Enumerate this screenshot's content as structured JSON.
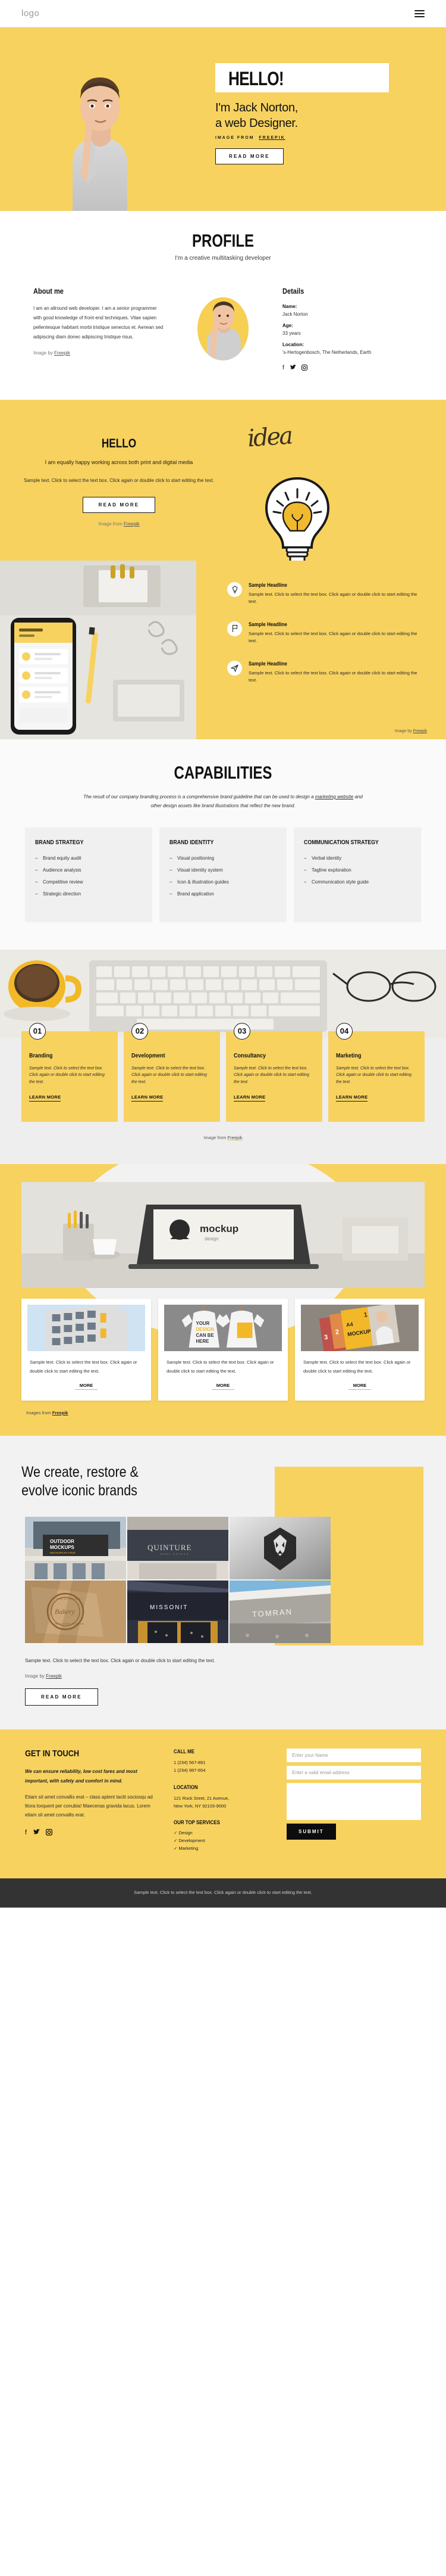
{
  "header": {
    "logo": "logo",
    "menu_icon": "hamburger-menu"
  },
  "hero": {
    "hello": "HELLO!",
    "headline_line1": "I'm Jack Norton,",
    "headline_line2": "a web Designer.",
    "credit_prefix": "IMAGE FROM",
    "credit_link": "FREEPIK",
    "cta": "READ MORE"
  },
  "profile": {
    "title": "PROFILE",
    "subtitle": "I'm a creative multitasking developer",
    "about_title": "About me",
    "about_text": "I am an allround web developer. I am a senior programmer with good knowledge of front-end techniques. Vitae sapien pellentesque habitant morbi tristique senectus et. Aenean sed adipiscing diam donec adipiscing tristique risus.",
    "about_credit_prefix": "Image by",
    "about_credit_link": "Freepik",
    "details_title": "Details",
    "details": [
      {
        "key": "Name:",
        "value": "Jack Norton"
      },
      {
        "key": "Age:",
        "value": "33 years"
      },
      {
        "key": "Location:",
        "value": "'s-Hertogenbosch, The Netherlands, Earth"
      }
    ],
    "socials": [
      "facebook-icon",
      "twitter-icon",
      "instagram-icon"
    ]
  },
  "hello_section": {
    "title": "HELLO",
    "lead": "I am equally happy working across both print and digital media",
    "body": "Sample text. Click to select the text box. Click again or double click to start editing the text.",
    "cta": "READ MORE",
    "credit_prefix": "Image from",
    "credit_link": "Freepik",
    "script_word": "idea"
  },
  "features": {
    "items": [
      {
        "icon": "lightbulb-icon",
        "title": "Sample Headline",
        "text": "Sample text. Click to select the text box. Click again or double click to start editing the text."
      },
      {
        "icon": "flag-icon",
        "title": "Sample Headline",
        "text": "Sample text. Click to select the text box. Click again or double click to start editing the text."
      },
      {
        "icon": "paper-plane-icon",
        "title": "Sample Headline",
        "text": "Sample text. Click to select the text box. Click again or double click to start editing the text."
      }
    ],
    "credit_prefix": "Image by",
    "credit_link": "Freepik"
  },
  "capabilities": {
    "title": "CAPABILITIES",
    "lead_part1": "The result of our company branding process is a comprehensive brand guideline that can be used to design a ",
    "lead_link": "marketing website",
    "lead_part2": " and other design assets like brand illustrations that reflect the new brand.",
    "cards": [
      {
        "title": "BRAND STRATEGY",
        "items": [
          "Brand equity audit",
          "Audience analysis",
          "Competitive review",
          "Strategic direction"
        ]
      },
      {
        "title": "BRAND IDENTITY",
        "items": [
          "Visual positioning",
          "Visual identity system",
          "Icon & illustration guides",
          "Brand application"
        ]
      },
      {
        "title": "COMMUNICATION STRATEGY",
        "items": [
          "Verbal identity",
          "Tagline exploration",
          "Communication style guide"
        ]
      }
    ]
  },
  "services": {
    "cards": [
      {
        "number": "01",
        "title": "Branding",
        "text": "Sample text. Click to select the text box. Click again or double click to start editing the text.",
        "cta": "LEARN MORE"
      },
      {
        "number": "02",
        "title": "Development",
        "text": "Sample text. Click to select the text box. Click again or double click to start editing the text.",
        "cta": "LEARN MORE"
      },
      {
        "number": "03",
        "title": "Consultancy",
        "text": "Sample text. Click to select the text box. Click again or double click to start editing the text.",
        "cta": "LEARN MORE"
      },
      {
        "number": "04",
        "title": "Marketing",
        "text": "Sample text. Click to select the text box. Click again or double click to start editing the text.",
        "cta": "LEARN MORE"
      }
    ],
    "credit_prefix": "Image from",
    "credit_link": "Freepik"
  },
  "mockups": {
    "cards": [
      {
        "text": "Sample text. Click to select the text box. Click again or double click to start editing the text.",
        "cta": "MORE"
      },
      {
        "text": "Sample text. Click to select the text box. Click again or double click to start editing the text.",
        "cta": "MORE"
      },
      {
        "text": "Sample text. Click to select the text box. Click again or double click to start editing the text.",
        "cta": "MORE"
      }
    ],
    "credit_prefix": "Images from",
    "credit_link": "Freepik",
    "mockup_label": "mockup"
  },
  "brands": {
    "title_line1": "We create, restore &",
    "title_line2": "evolve iconic brands",
    "gallery_labels": [
      "OUTDOOR MOCKUPS",
      "QUINTURE",
      "lion-logo",
      "bakery-stamp",
      "MISSONIT",
      "TOMRAN"
    ],
    "text": "Sample text. Click to select the text box. Click again or double click to start editing the text.",
    "credit_prefix": "Image by",
    "credit_link": "Freepik",
    "cta": "READ MORE"
  },
  "footer": {
    "title": "GET IN TOUCH",
    "lead": "We can ensure reliability, low cost fares and most important, with safety and comfort in mind.",
    "body": "Etiam sit amet convallis erat – class aptent taciti sociosqu ad litora torquent per conubia! Maecenas gravida lacus. Lorem etiam sit amet convallis erat.",
    "socials": [
      "facebook-icon",
      "twitter-icon",
      "instagram-icon"
    ],
    "call_title": "CALL ME",
    "phone1": "1 (234) 567-891",
    "phone2": "1 (234) 987-654",
    "location_title": "LOCATION",
    "address_line1": "121 Rock Sreet, 21 Avenue,",
    "address_line2": "New York, NY 92103-9000",
    "services_title": "OUR TOP SERVICES",
    "services": [
      "Design",
      "Development",
      "Marketing"
    ],
    "form": {
      "name_placeholder": "Enter your Name",
      "email_placeholder": "Enter a valid email address",
      "message_placeholder": "",
      "submit": "SUBMIT"
    },
    "bottom_text": "Sample text. Click to select the text box. Click again or double click to start editing the text."
  },
  "colors": {
    "yellow": "#f7d25f",
    "dark": "#333333",
    "light_gray": "#f2f2f2"
  }
}
